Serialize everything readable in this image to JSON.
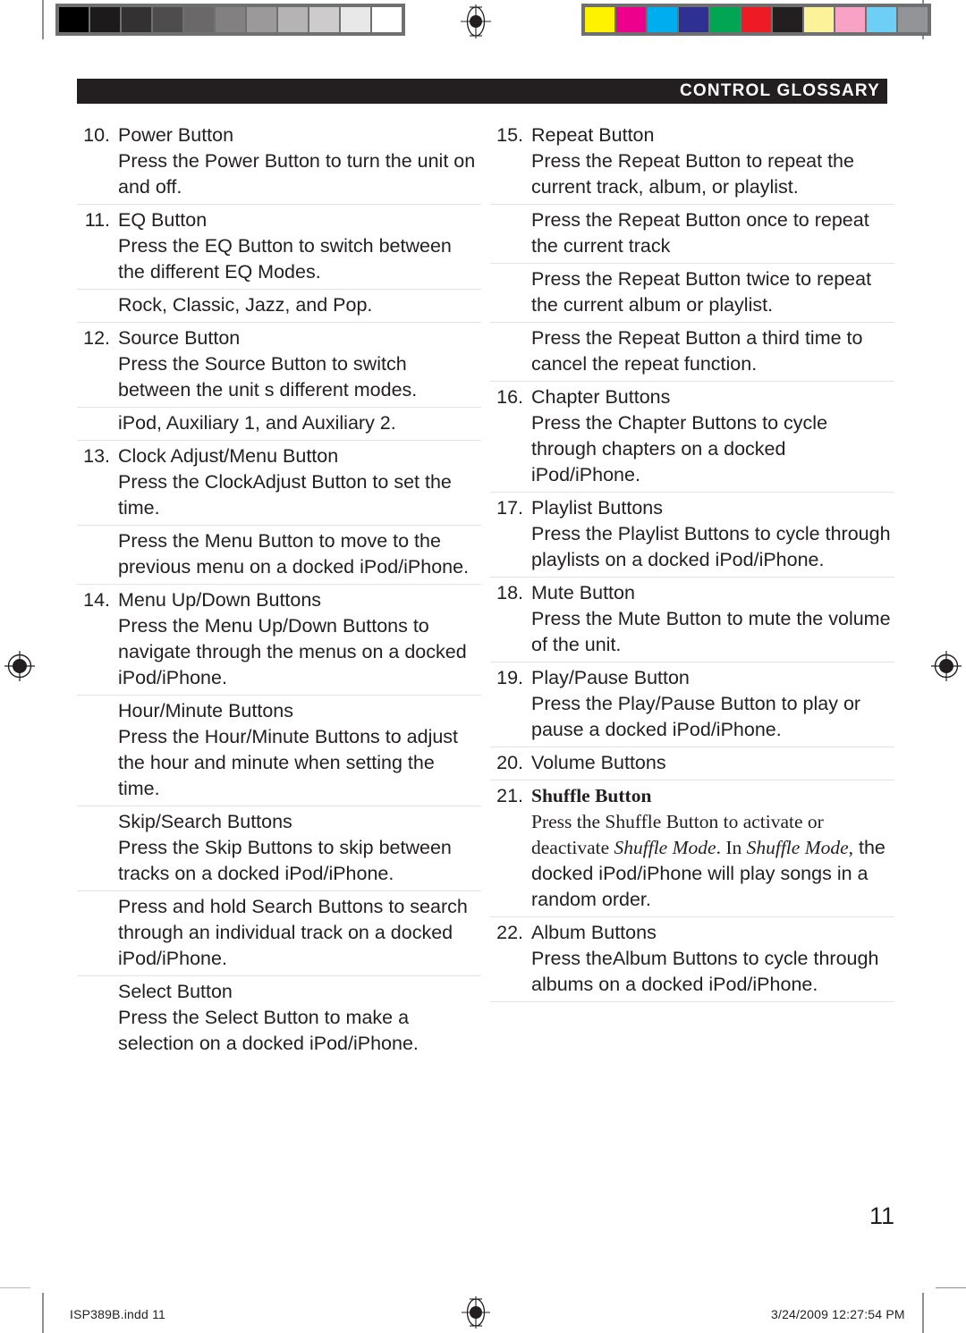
{
  "header": {
    "title": "CONTROL GLOSSARY"
  },
  "page_number": "11",
  "footer": {
    "file_label": "ISP389B.indd   11",
    "date_label": "3/24/2009   12:27:54 PM"
  },
  "calibration": {
    "grayscale_swatches": [
      "#000000",
      "#1c1a1b",
      "#343132",
      "#4f4c4d",
      "#6b6869",
      "#838081",
      "#9c999a",
      "#b5b3b3",
      "#cdcbcb",
      "#e9e8e8",
      "#ffffff"
    ],
    "color_swatches": [
      "#fff200",
      "#ec008c",
      "#00aeef",
      "#2e3192",
      "#00a651",
      "#ed1c24",
      "#231f20",
      "#fbf29a",
      "#f8a3c6",
      "#6dcff6",
      "#929497"
    ]
  },
  "left_column": [
    {
      "num": "10.",
      "title": "Power Button",
      "desc": "Press the Power Button to turn the unit on and off.",
      "rule_above": false,
      "style": "sans"
    },
    {
      "num": "11.",
      "title": "EQ Button",
      "desc": "Press the EQ Button to switch between the different EQ Modes.",
      "rule_above": true,
      "style": "sans"
    },
    {
      "num": "",
      "title": "",
      "desc": "Rock, Classic, Jazz, and Pop.",
      "rule_above": true,
      "style": "sans"
    },
    {
      "num": "12.",
      "title": "Source Button",
      "desc": "Press the Source Button to switch between the unit s different modes.",
      "rule_above": true,
      "style": "sans"
    },
    {
      "num": "",
      "title": "",
      "desc": "iPod, Auxiliary 1, and Auxiliary 2.",
      "rule_above": true,
      "style": "sans"
    },
    {
      "num": "13.",
      "title": "Clock Adjust/Menu Button",
      "desc": "Press the ClockAdjust Button to set the time.",
      "rule_above": true,
      "style": "sans"
    },
    {
      "num": "",
      "title": "",
      "desc": "Press the Menu Button to move to the previous menu on a docked iPod/iPhone.",
      "rule_above": true,
      "style": "sans"
    },
    {
      "num": "14.",
      "title": "Menu Up/Down Buttons",
      "desc": "Press the Menu Up/Down Buttons to navigate through the menus on a docked iPod/iPhone.",
      "rule_above": true,
      "style": "sans"
    },
    {
      "num": "",
      "title": "Hour/Minute Buttons",
      "desc": "Press the Hour/Minute Buttons to adjust the hour and minute when setting the time.",
      "rule_above": true,
      "style": "sans"
    },
    {
      "num": "",
      "title": "Skip/Search Buttons",
      "desc": "Press the Skip Buttons to skip between tracks on a docked iPod/iPhone.",
      "rule_above": true,
      "style": "sans"
    },
    {
      "num": "",
      "title": "",
      "desc": "Press and hold Search Buttons to search through an individual track on a docked iPod/iPhone.",
      "rule_above": true,
      "style": "sans"
    },
    {
      "num": "",
      "title": "Select Button",
      "desc": "Press the Select Button to make a selection on a docked iPod/iPhone.",
      "rule_above": true,
      "style": "sans"
    }
  ],
  "right_column": [
    {
      "num": "15.",
      "title": "Repeat Button",
      "desc": "Press the Repeat Button to repeat the current track, album, or playlist.",
      "rule_above": false,
      "style": "sans"
    },
    {
      "num": "",
      "title": "",
      "desc": "Press the Repeat Button once to repeat the current track",
      "rule_above": true,
      "style": "sans"
    },
    {
      "num": "",
      "title": "",
      "desc": "Press the Repeat Button twice to repeat the current album or playlist.",
      "rule_above": true,
      "style": "sans"
    },
    {
      "num": "",
      "title": "",
      "desc": "Press the Repeat Button a third time to cancel the repeat function.",
      "rule_above": true,
      "style": "sans"
    },
    {
      "num": "16.",
      "title": "Chapter Buttons",
      "desc": "Press the Chapter Buttons to cycle through chapters on a docked iPod/iPhone.",
      "rule_above": true,
      "style": "sans"
    },
    {
      "num": "17.",
      "title": "Playlist Buttons",
      "desc": "Press the Playlist Buttons to cycle through playlists on a docked iPod/iPhone.",
      "rule_above": true,
      "style": "sans"
    },
    {
      "num": "18.",
      "title": "Mute Button",
      "desc": "Press the Mute Button to mute the volume of the unit.",
      "rule_above": true,
      "style": "sans"
    },
    {
      "num": "19.",
      "title": "Play/Pause Button",
      "desc": "Press the Play/Pause Button to play or pause a docked iPod/iPhone.",
      "rule_above": true,
      "style": "sans"
    },
    {
      "num": "20.",
      "title": "Volume Buttons",
      "desc": "",
      "rule_above": true,
      "style": "sans"
    },
    {
      "num": "21.",
      "title": "Shuffle Button",
      "desc_serif_lead": "Press the Shuffle Button to activate or deactivate ",
      "desc_italic_1": "Shuffle Mode",
      "desc_serif_mid": ". In ",
      "desc_italic_2": "Shuffle Mode",
      "desc_serif_comma": ",",
      "desc_sans_tail": "the docked iPod/iPhone will play songs in a random order.",
      "rule_above": true,
      "style": "serif"
    },
    {
      "num": "22.",
      "title": "Album Buttons",
      "desc": "Press theAlbum Buttons to cycle through albums on a docked iPod/iPhone.",
      "rule_above": true,
      "style": "sans"
    },
    {
      "num": "",
      "title": "",
      "desc": "",
      "rule_above": true,
      "style": "sans"
    }
  ]
}
